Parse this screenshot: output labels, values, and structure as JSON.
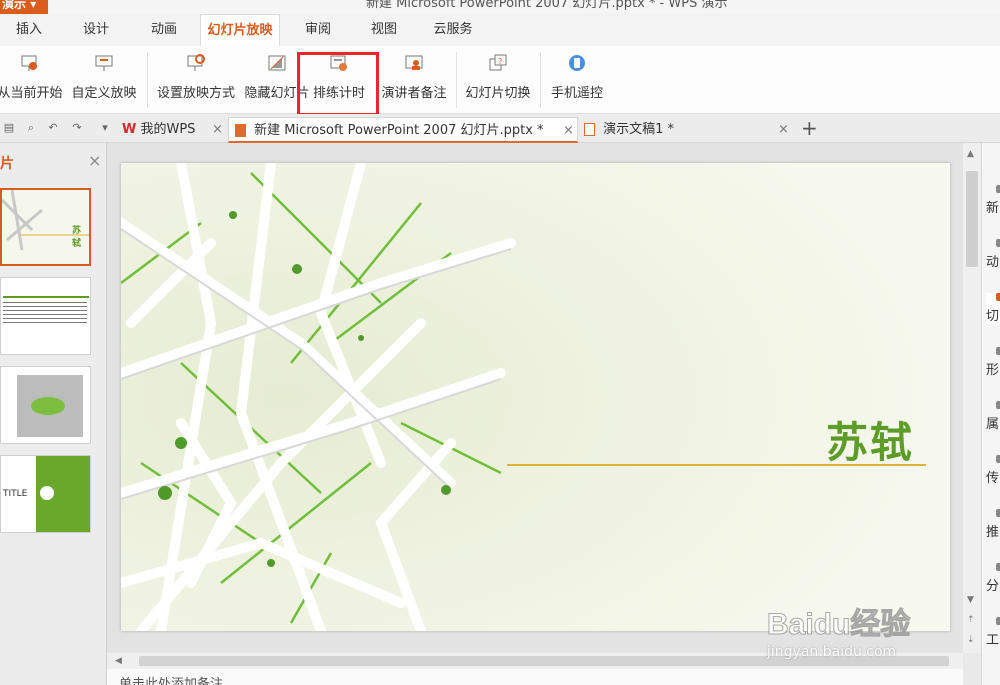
{
  "window": {
    "app_button": "演示",
    "title": "新建 Microsoft PowerPoint 2007 幻灯片.pptx * - WPS 演示"
  },
  "ribbon_tabs": [
    "插入",
    "设计",
    "动画",
    "幻灯片放映",
    "审阅",
    "视图",
    "云服务"
  ],
  "ribbon_active_tab": "幻灯片放映",
  "ribbon_buttons": [
    "从当前开始",
    "自定义放映",
    "设置放映方式",
    "隐藏幻灯片",
    "排练计时",
    "演讲者备注",
    "幻灯片切换",
    "手机遥控"
  ],
  "doc_tabs": [
    {
      "label": "我的WPS"
    },
    {
      "label": "新建 Microsoft PowerPoint 2007 幻灯片.pptx *"
    },
    {
      "label": "演示文稿1 *"
    }
  ],
  "left_pane": {
    "title": "片",
    "thumb1_title": "苏轼",
    "thumb4_title": "TITLE"
  },
  "slide": {
    "title": "苏轼"
  },
  "notes_placeholder": "单击此处添加备注",
  "right_pane": [
    "新",
    "动",
    "切",
    "形",
    "属",
    "传",
    "推",
    "分",
    "工"
  ],
  "watermark": {
    "logo": "Baidu经验",
    "url": "jingyan.baidu.com"
  },
  "colors": {
    "accent": "#d95b1e",
    "highlight_box": "#e8262b",
    "slide_title": "#5c9c27",
    "slide_line": "#e0b13a"
  }
}
